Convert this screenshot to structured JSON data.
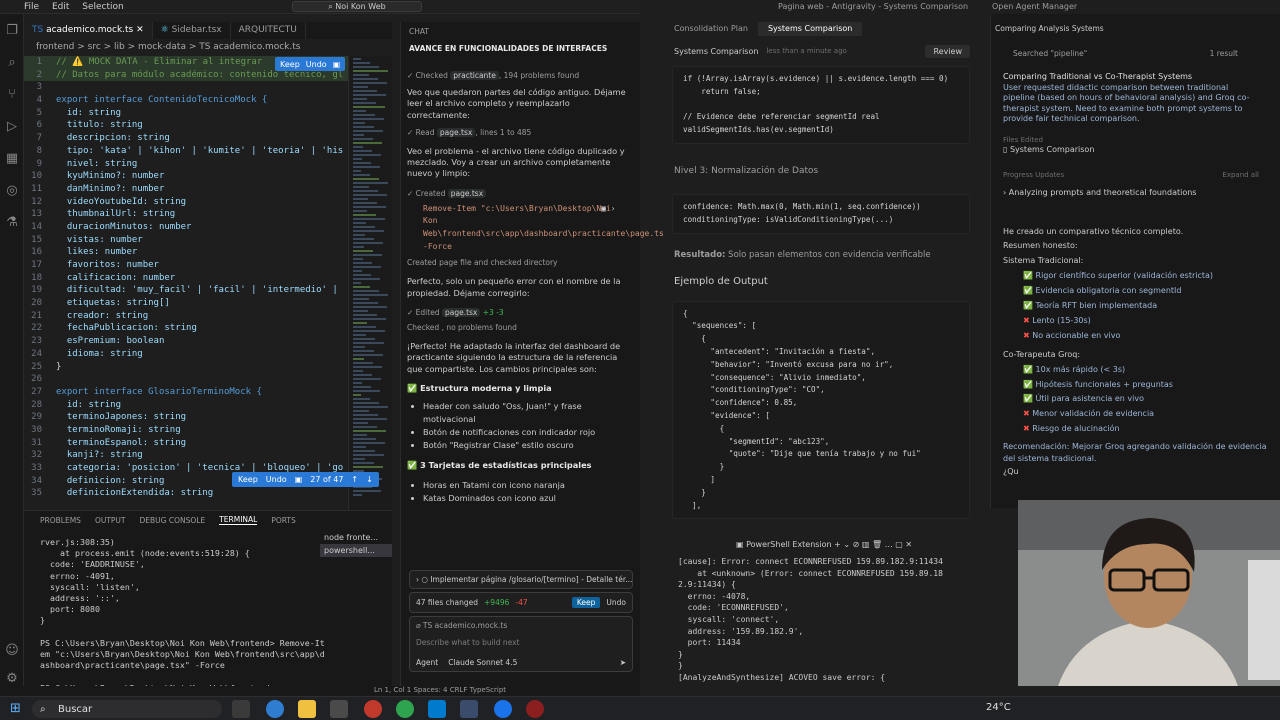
{
  "vscode": {
    "menu": [
      "File",
      "Edit",
      "Selection"
    ],
    "title_search": "Noi Kon Web",
    "tabs": [
      "academico.mock.ts",
      "Sidebar.tsx",
      "ARQUITECTU"
    ],
    "breadcrumb": "frontend > src > lib > mock-data > TS academico.mock.ts",
    "code_lines": [
      {
        "n": "1",
        "t": "// ⚠️ MOCK DATA - Eliminar al integrar"
      },
      {
        "n": "2",
        "t": "// Datos para módulo académico: contenido técnico, gl"
      },
      {
        "n": "3",
        "t": ""
      },
      {
        "n": "4",
        "t": "export interface ContenidoTecnicoMock {"
      },
      {
        "n": "5",
        "t": "  id: string"
      },
      {
        "n": "6",
        "t": "  titulo: string"
      },
      {
        "n": "7",
        "t": "  descripcion: string"
      },
      {
        "n": "8",
        "t": "  tipo: 'kata' | 'kihon' | 'kumite' | 'teoria' | 'his"
      },
      {
        "n": "9",
        "t": "  nivel: string"
      },
      {
        "n": "10",
        "t": "  kyuMinimo?: number"
      },
      {
        "n": "11",
        "t": "  danMinimo?: number"
      },
      {
        "n": "12",
        "t": "  videoYoutubeId: string"
      },
      {
        "n": "13",
        "t": "  thumbnailUrl: string"
      },
      {
        "n": "14",
        "t": "  duracionMinutos: number"
      },
      {
        "n": "15",
        "t": "  vistas: number"
      },
      {
        "n": "16",
        "t": "  likes: number"
      },
      {
        "n": "17",
        "t": "  favoritos: number"
      },
      {
        "n": "18",
        "t": "  calificacion: number"
      },
      {
        "n": "19",
        "t": "  dificultad: 'muy_facil' | 'facil' | 'intermedio' |"
      },
      {
        "n": "20",
        "t": "  etiquetas: string[]"
      },
      {
        "n": "21",
        "t": "  creador: string"
      },
      {
        "n": "22",
        "t": "  fechaPublicacion: string"
      },
      {
        "n": "23",
        "t": "  esPremium: boolean"
      },
      {
        "n": "24",
        "t": "  idioma: string"
      },
      {
        "n": "25",
        "t": "}"
      },
      {
        "n": "26",
        "t": ""
      },
      {
        "n": "27",
        "t": "export interface GlosarioTerminoMock {"
      },
      {
        "n": "28",
        "t": "  id: string"
      },
      {
        "n": "29",
        "t": "  terminoJapones: string"
      },
      {
        "n": "30",
        "t": "  terminoRomaji: string"
      },
      {
        "n": "31",
        "t": "  terminoEspanol: string"
      },
      {
        "n": "32",
        "t": "  kanji?: string"
      },
      {
        "n": "33",
        "t": "  categoria: 'posicion' | 'tecnica' | 'bloqueo' | 'go"
      },
      {
        "n": "34",
        "t": "  definicion: string"
      },
      {
        "n": "35",
        "t": "  definicionExtendida: string"
      }
    ],
    "keep_label": "Keep",
    "undo_label": "Undo",
    "change_counter": "27 of 47",
    "panel_tabs": [
      "PROBLEMS",
      "OUTPUT",
      "DEBUG CONSOLE",
      "TERMINAL",
      "PORTS"
    ],
    "terminal": "rver.js:308:35)\n    at process.emit (node:events:519:28) {\n  code: 'EADDRINUSE',\n  errno: -4091,\n  syscall: 'listen',\n  address: '::',\n  port: 8080\n}\n\nPS C:\\Users\\Bryan\\Desktop\\Noi Kon Web\\frontend> Remove-It\nem \"c:\\Users\\Bryan\\Desktop\\Noi Kon Web\\frontend\\src\\app\\d\nashboard\\practicante\\page.tsx\" -Force\n\nPS C:\\Users\\Bryan\\Desktop\\Noi Kon Web\\frontend> ",
    "terminal_list": [
      "node fronte...",
      "powershell..."
    ],
    "status": "Ln 1, Col 1   Spaces: 4   CRLF   TypeScript"
  },
  "chat": {
    "header": "CHAT",
    "title": "AVANCE EN FUNCIONALIDADES DE INTERFACES",
    "checked_1": "Checked",
    "checked_1_file": "practicante",
    "checked_1_tail": ", 194 problems found",
    "msg_1": "Veo que quedaron partes del código antiguo. Déjame leer el archivo completo y reemplazarlo correctamente:",
    "read_label": "Read",
    "read_file": "page.tsx",
    "read_tail": ", lines 1 to 485",
    "msg_2": "Veo el problema - el archivo tiene código duplicado y mezclado. Voy a crear un archivo completamente nuevo y limpio:",
    "created_label": "Created",
    "created_file": "page.tsx",
    "cmd": "Remove-Item \"c:\\Users\\Bryan\\Desktop\\Noi Kon Web\\frontend\\src\\app\\dashboard\\practicante\\page.tsx\" -Force",
    "created_dir": "Created page file and checked directory",
    "msg_3": "Perfecto, solo un pequeño error con el nombre de la propiedad. Déjame corregirlo:",
    "edited_label": "Edited",
    "edited_file": "page.tsx",
    "edited_diff": "+3 -3",
    "checked_2": "Checked , no problems found",
    "msg_4": "¡Perfecto! He adaptado la interfaz del dashboard de practicante siguiendo la estructura de la referencia que compartiste. Los cambios principales son:",
    "h1": "Estructura moderna y limpia",
    "b1": [
      "Header con saludo \"Oss, Juan!\" y frase motivacional",
      "Botón de notificaciones con indicador rojo",
      "Botón \"Registrar Clase\" estilo oscuro"
    ],
    "h2": "3 Tarjetas de estadísticas principales",
    "b2": [
      "Horas en Tatami con icono naranja",
      "Katas Dominados con icono azul"
    ],
    "todo": "Implementar página /glosario/[termino] - Detalle tér...",
    "files_changed": "47 files changed",
    "files_plus": "+9496",
    "files_minus": "-47",
    "keep": "Keep",
    "undo": "Undo",
    "attach_file": "TS academico.mock.ts",
    "placeholder": "Describe what to build next",
    "agent": "Agent",
    "model": "Claude Sonnet 4.5"
  },
  "antigravity": {
    "title": "Pagina web - Antigravity - Systems Comparison",
    "open_agent_manager": "Open Agent Manager",
    "tabs": [
      "Consolidation Plan",
      "Systems Comparison"
    ],
    "doc_title": "Systems Comparison",
    "doc_time": "less than a minute ago",
    "review": "Review",
    "code1": "if (!Array.isArray(s.evidence) || s.evidence.length === 0)\n    return false;\n\n// Evidence debe referenciar segmentId real\nvalidSegmentIds.has(ev.segmentId)",
    "level3": "Nivel 3: Normalización de Datos",
    "code2": "confidence: Math.max(0, Math.min(1, seq.confidence))\nconditioningType: isValidConditioningType(...)",
    "result_label": "Resultado:",
    "result_text": "Solo pasan elementos con evidencia verificable",
    "output_heading": "Ejemplo de Output",
    "code3": "{\n  \"sequences\": [\n    {\n      \"antecedent\": \"Invitación a fiesta\",\n      \"behavior\": \"Inventó excusa para no ir\",\n      \"consequence\": \"Alivio inmediato\",\n      \"conditioningType\": \"CO\",\n      \"confidence\": 0.85,\n      \"evidence\": [\n        {\n          \"segmentId\": \"abc123\",\n          \"quote\": \"Dije que tenía trabajo y no fui\"\n        }\n      ]\n    }\n  ],"
  },
  "side": {
    "header": "Comparing Analysis Systems",
    "search_label": "Searched \"pipeline\"",
    "search_count": "1 result",
    "card_title": "Comparing Traditional vs Co-Therapist Systems",
    "card_text": "User requested didactic comparison between traditional pipeline (based on hours of behavioral analysis) and Groq co-therapist system. Need to examine both prompt systems to provide fair technical comparison.",
    "files_edited": "Files Edited",
    "file": "Systems Comparison",
    "progress": "Progress Updates",
    "expand": "Expand all",
    "progress_item": "Analyzing prompts and theoretical foundations",
    "summary": "He creado un comparativo técnico completo.",
    "honest": "Resumen honesto:",
    "trad": "Sistema Tradicional:",
    "trad_items": [
      {
        "ok": true,
        "t": "Rigor científico superior (validación estricta)"
      },
      {
        "ok": true,
        "t": "Evidencia obligatoria con segmentId"
      },
      {
        "ok": true,
        "t": "Teoría RFT bien implementada"
      },
      {
        "ok": false,
        "t": "Lento (15-30s)"
      },
      {
        "ok": false,
        "t": "No accionable en vivo"
      }
    ],
    "co": "Co-Terapeuta Groq:",
    "co_items": [
      {
        "ok": true,
        "t": "10x más rápido (< 3s)"
      },
      {
        "ok": true,
        "t": "Hipótesis funcionales + preguntas"
      },
      {
        "ok": true,
        "t": "Útil para asistencia en vivo"
      },
      {
        "ok": false,
        "t": "Menor validación de evidencia"
      },
      {
        "ok": false,
        "t": "Riesgo de alucinación"
      }
    ],
    "recommendation": "Recomendación: Mejorar Groq agregando validación de evidencia del sistema tradicional.",
    "tail": "¿Qu"
  },
  "powershell": {
    "label": "PowerShell Extension",
    "text": "[cause]: Error: connect ECONNREFUSED 159.89.182.9:11434\n    at <unknown> (Error: connect ECONNREFUSED 159.89.18\n2.9:11434) {\n  errno: -4078,\n  code: 'ECONNREFUSED',\n  syscall: 'connect',\n  address: '159.89.182.9',\n  port: 11434\n}\n}\n[AnalyzeAndSynthesize] ACOVEO save error: {"
  },
  "taskbar": {
    "search": "Buscar",
    "temp": "24°C"
  }
}
